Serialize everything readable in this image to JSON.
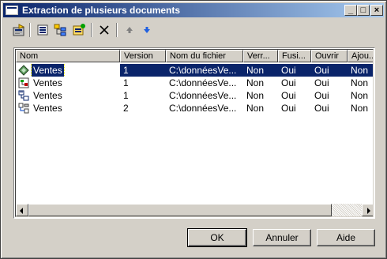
{
  "window": {
    "title": "Extraction de plusieurs documents"
  },
  "titlebar_buttons": {
    "minimize": "_",
    "maximize": "□",
    "close": "×"
  },
  "toolbar": {
    "items": [
      {
        "name": "properties-icon"
      },
      {
        "name": "select-all-icon"
      },
      {
        "name": "tree-icon"
      },
      {
        "name": "add-documents-icon"
      },
      {
        "name": "delete-icon"
      },
      {
        "name": "move-up-icon"
      },
      {
        "name": "move-down-icon"
      }
    ]
  },
  "table": {
    "columns": [
      "Nom",
      "Version",
      "Nom du fichier",
      "Verr...",
      "Fusi...",
      "Ouvrir",
      "Ajou..."
    ],
    "rows": [
      {
        "icon": "model-icon-1",
        "cells": [
          "Ventes",
          "1",
          "C:\\donnéesVe...",
          "Non",
          "Oui",
          "Oui",
          "Non"
        ],
        "selected": true
      },
      {
        "icon": "model-icon-2",
        "cells": [
          "Ventes",
          "1",
          "C:\\donnéesVe...",
          "Non",
          "Oui",
          "Oui",
          "Non"
        ],
        "selected": false
      },
      {
        "icon": "model-icon-3",
        "cells": [
          "Ventes",
          "1",
          "C:\\donnéesVe...",
          "Non",
          "Oui",
          "Oui",
          "Non"
        ],
        "selected": false
      },
      {
        "icon": "model-icon-4",
        "cells": [
          "Ventes",
          "2",
          "C:\\donnéesVe...",
          "Non",
          "Oui",
          "Oui",
          "Non"
        ],
        "selected": false
      }
    ]
  },
  "buttons": {
    "ok": "OK",
    "cancel": "Annuler",
    "help": "Aide"
  }
}
